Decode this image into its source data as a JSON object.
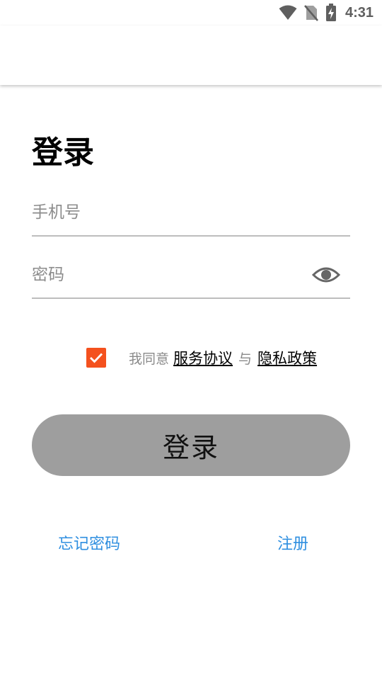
{
  "status_bar": {
    "time": "4:31",
    "icons": [
      "wifi-icon",
      "no-sim-icon",
      "battery-charging-icon"
    ]
  },
  "page": {
    "title": "登录"
  },
  "form": {
    "phone_placeholder": "手机号",
    "password_placeholder": "密码",
    "password_toggle_icon": "eye-icon"
  },
  "agreement": {
    "checked": true,
    "prefix": "我同意",
    "service_link": "服务协议",
    "connector": "与",
    "privacy_link": "隐私政策"
  },
  "login_button": {
    "label": "登录",
    "color": "#9e9e9e"
  },
  "links": {
    "forgot_password": "忘记密码",
    "register": "注册"
  },
  "colors": {
    "checkbox": "#f4511e",
    "link": "#2f8fe0",
    "underline": "#bdbdbd"
  }
}
